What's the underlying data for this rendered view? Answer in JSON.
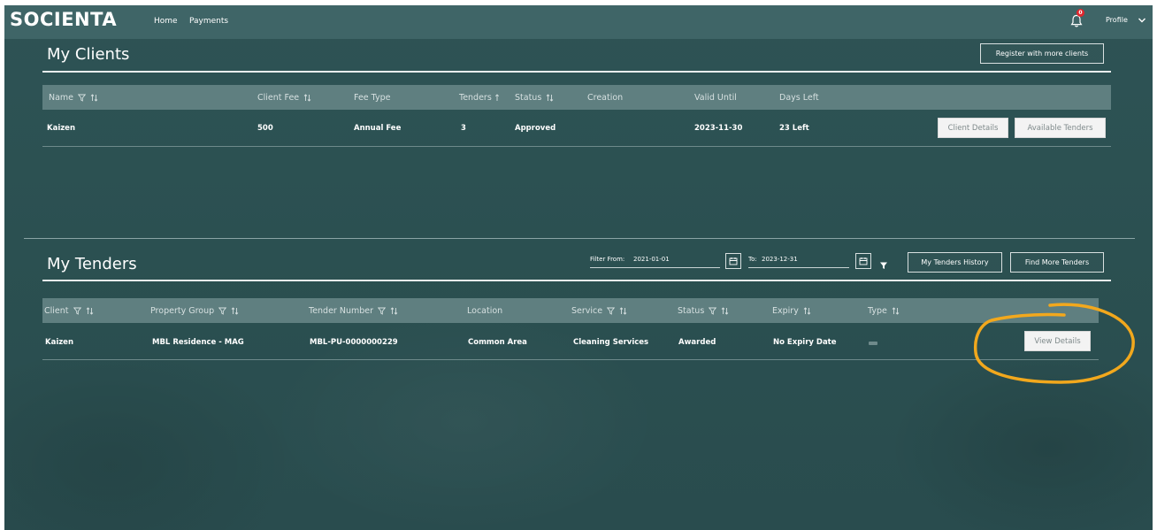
{
  "brand": {
    "logo": "SOCIENTA"
  },
  "nav": {
    "home": "Home",
    "payments": "Payments",
    "notifications_count": "0",
    "profile": "Profile"
  },
  "clients": {
    "title": "My Clients",
    "register_button": "Register with more clients",
    "columns": [
      "Name",
      "Client Fee",
      "Fee Type",
      "Tenders",
      "Status",
      "Creation",
      "Valid Until",
      "Days Left"
    ],
    "rows": [
      {
        "name": "Kaizen",
        "fee": "500",
        "fee_type": "Annual Fee",
        "tenders": "3",
        "status": "Approved",
        "creation": "",
        "valid_until": "2023-11-30",
        "days_left": "23 Left"
      }
    ],
    "client_details_button": "Client Details",
    "available_tenders_button": "Available Tenders"
  },
  "tenders": {
    "title": "My Tenders",
    "filter_from_label": "Filter From:",
    "filter_from_value": "2021-01-01",
    "filter_to_label": "To:",
    "filter_to_value": "2023-12-31",
    "history_button": "My Tenders History",
    "find_more_button": "Find More Tenders",
    "columns": [
      "Client",
      "Property Group",
      "Tender Number",
      "Location",
      "Service",
      "Status",
      "Expiry",
      "Type"
    ],
    "rows": [
      {
        "client": "Kaizen",
        "property_group": "MBL Residence - MAG",
        "tender_number": "MBL-PU-0000000229",
        "location": "Common Area",
        "service": "Cleaning Services",
        "status": "Awarded",
        "expiry": "No Expiry Date"
      }
    ],
    "view_details_button": "View Details"
  },
  "colors": {
    "background": "#2b5051",
    "navbar": "#3f6567",
    "table_header": "#5f7f80",
    "annotation": "#f2a81d",
    "badge": "#e0262d"
  },
  "icons": [
    "bell-icon",
    "chevron-down-icon",
    "filter-icon",
    "sort-icon",
    "calendar-icon"
  ]
}
